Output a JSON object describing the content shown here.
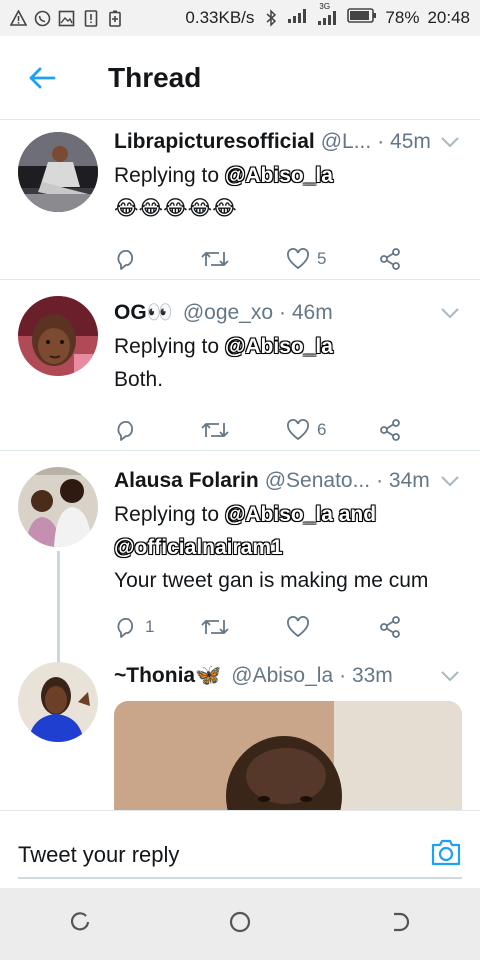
{
  "status": {
    "speed": "0.33KB/s",
    "network": "3G",
    "battery": "78%",
    "time": "20:48"
  },
  "header": {
    "title": "Thread"
  },
  "tweets": [
    {
      "name": "Librapicturesofficial",
      "handle": "@L...",
      "time": "· 45m",
      "replying_prefix": "Replying to",
      "replying_to": "@Abiso_la",
      "replying_extra": "",
      "text": "😂😂😂😂😂",
      "replies": "",
      "likes": "5"
    },
    {
      "name": "OG👀",
      "handle": "@oge_xo",
      "time": "· 46m",
      "replying_prefix": "Replying to",
      "replying_to": "@Abiso_la",
      "replying_extra": "",
      "text": "Both.",
      "replies": "",
      "likes": "6"
    },
    {
      "name": "Alausa Folarin",
      "handle": "@Senato...",
      "time": "· 34m",
      "replying_prefix": "Replying to",
      "replying_to": "@Abiso_la and",
      "replying_extra": "@officialnairam1",
      "text": "Your tweet gan is making me cum",
      "replies": "1",
      "likes": ""
    },
    {
      "name": "~Thonia🦋",
      "handle": "@Abiso_la",
      "time": "· 33m"
    }
  ],
  "composer": {
    "placeholder": "Tweet your reply"
  },
  "colors": {
    "accent": "#1da1f2",
    "secondary": "#657786",
    "divider": "#e1e8ed"
  },
  "icons": [
    "back-arrow-icon",
    "reply-icon",
    "retweet-icon",
    "like-icon",
    "share-icon",
    "chevron-down-icon",
    "camera-icon"
  ]
}
